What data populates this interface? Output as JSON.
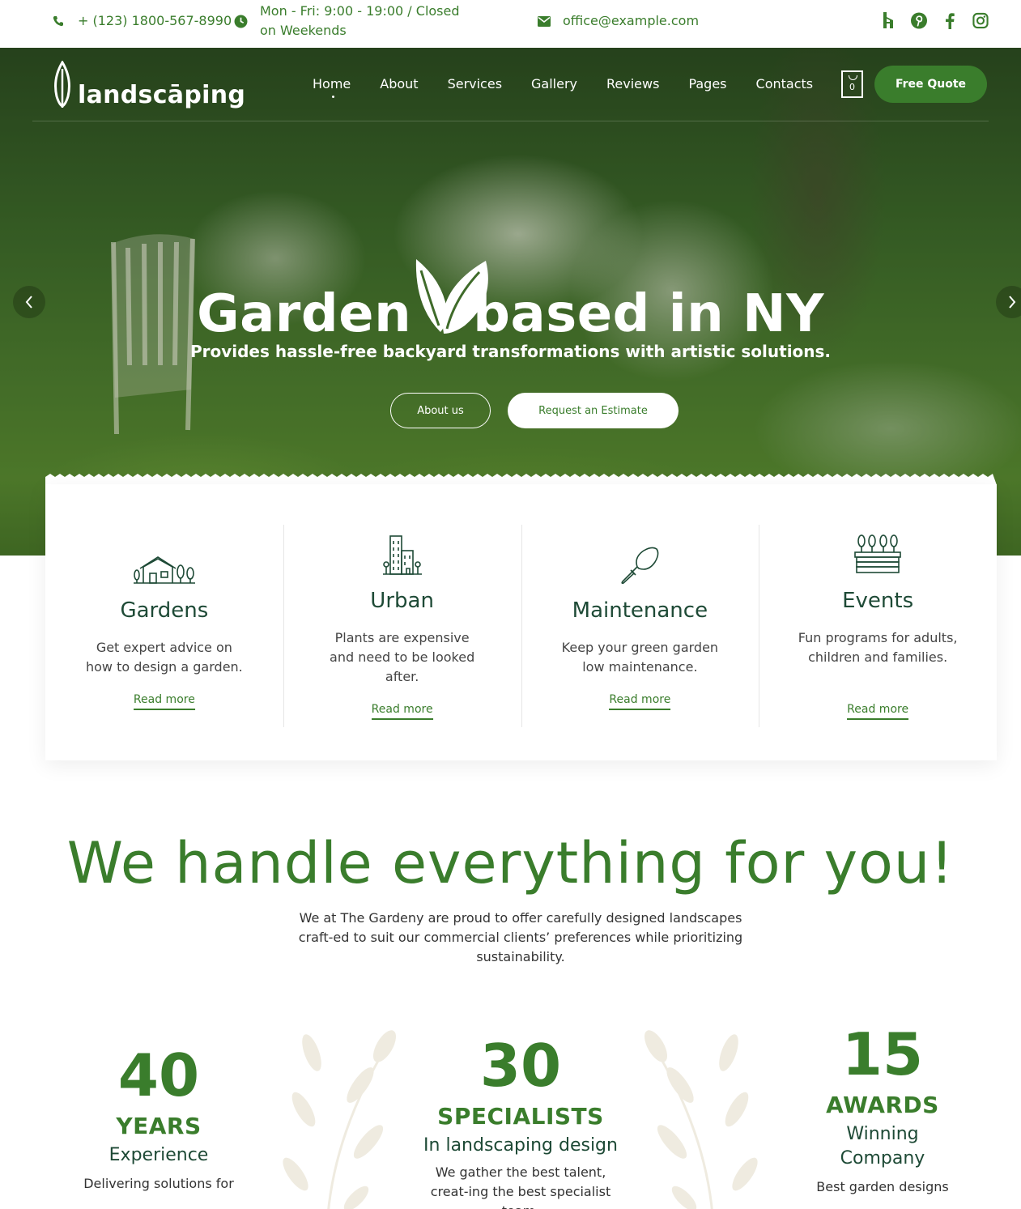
{
  "topbar": {
    "phone": "+ (123) 1800-567-8990",
    "hours": "Mon - Fri: 9:00 - 19:00 / Closed on Weekends",
    "email": "office@example.com",
    "socials": [
      "houzz-icon",
      "pinterest-icon",
      "facebook-icon",
      "instagram-icon"
    ]
  },
  "header": {
    "logo": "landscāping",
    "nav": [
      "Home",
      "About",
      "Services",
      "Gallery",
      "Reviews",
      "Pages",
      "Contacts"
    ],
    "active_nav": "Home",
    "cart_count": "0",
    "quote_button": "Free Quote"
  },
  "hero": {
    "title_left": "Garden",
    "title_right": "based in NY",
    "subtitle": "Provides hassle-free backyard transformations with artistic solutions.",
    "button_about": "About us",
    "button_estimate": "Request an Estimate"
  },
  "services": [
    {
      "title": "Gardens",
      "desc": "Get expert advice on how to design a garden.",
      "link": "Read more",
      "icon": "house-trees-icon"
    },
    {
      "title": "Urban",
      "desc": "Plants are expensive and need to be looked after.",
      "link": "Read more",
      "icon": "buildings-icon"
    },
    {
      "title": "Maintenance",
      "desc": "Keep your green garden low maintenance.",
      "link": "Read more",
      "icon": "trowel-icon"
    },
    {
      "title": "Events",
      "desc": "Fun programs for adults, children and families.",
      "link": "Read more",
      "icon": "planter-icon"
    }
  ],
  "about": {
    "headline": "We handle everything for you!",
    "intro": "We at The Gardeny are proud to offer carefully designed landscapes craft-ed to suit our commercial clients’ preferences while prioritizing sustainability."
  },
  "stats": [
    {
      "number": "40",
      "label": "YEARS",
      "sub": "Experience",
      "desc": "Delivering solutions for"
    },
    {
      "number": "30",
      "label": "SPECIALISTS",
      "sub": "In landscaping design",
      "desc": "We gather the best talent, creat-ing the best specialist team."
    },
    {
      "number": "15",
      "label": "AWARDS",
      "sub": "Winning Company",
      "desc": "Best garden designs"
    }
  ],
  "colors": {
    "brand_green": "#3a7d2c",
    "dark_green": "#1e4a36",
    "leaf_beige": "#efebe0"
  }
}
